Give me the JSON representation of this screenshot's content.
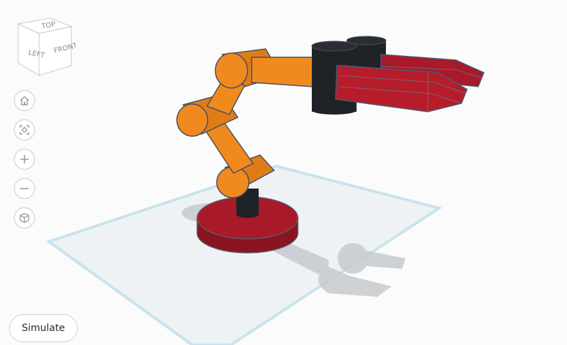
{
  "viewport": {
    "view_cube": {
      "faces": [
        "LEFT",
        "FRONT",
        "TOP"
      ]
    },
    "nav_controls": {
      "home_icon": "home-icon",
      "fit_icon": "fit-view-icon",
      "zoom_in_icon": "plus-icon",
      "zoom_out_icon": "minus-icon",
      "projection_icon": "cube-outline-icon"
    },
    "model": {
      "description_colors": {
        "arm": "#f08a1f",
        "base": "#a8192a",
        "joint": "#1f2226",
        "gripper": "#b71c2a",
        "workplane_edge": "#bfe0ec",
        "workplane_fill": "#eef2f4"
      }
    },
    "simulate_label": "Simulate"
  }
}
